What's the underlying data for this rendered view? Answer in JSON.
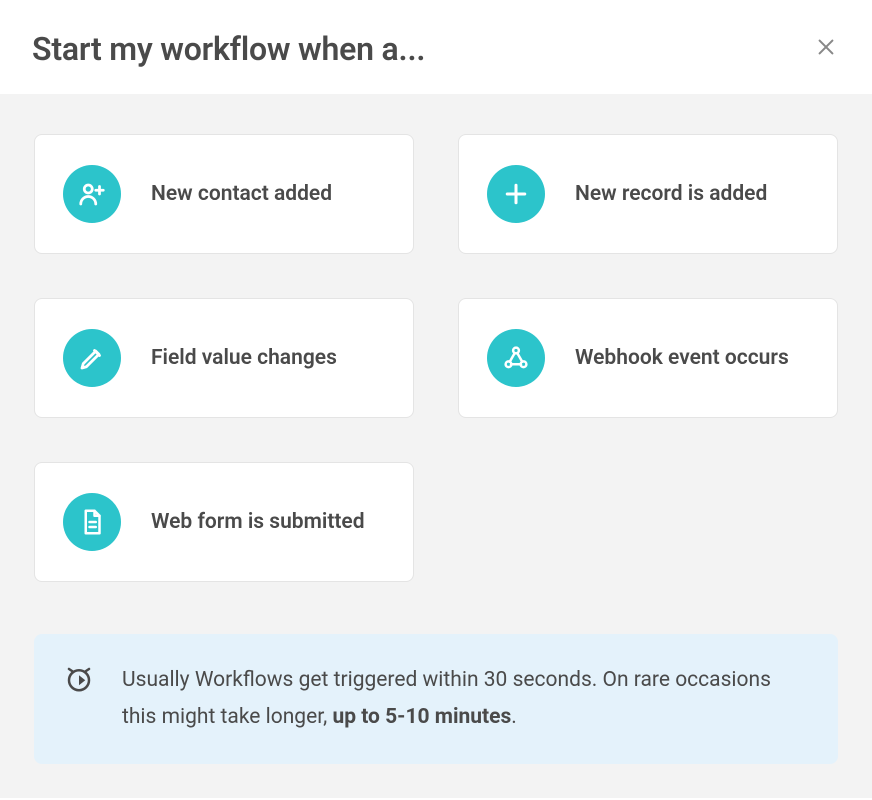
{
  "header": {
    "title": "Start my workflow when a..."
  },
  "triggers": [
    {
      "icon": "person-plus-icon",
      "label": "New contact added"
    },
    {
      "icon": "plus-icon",
      "label": "New record is added"
    },
    {
      "icon": "pencil-icon",
      "label": "Field value changes"
    },
    {
      "icon": "webhook-icon",
      "label": "Webhook event occurs"
    },
    {
      "icon": "form-icon",
      "label": "Web form is submitted"
    }
  ],
  "info": {
    "text_prefix": "Usually Workflows get triggered within 30 seconds. On rare occasions this might take longer, ",
    "text_bold": "up to 5-10 minutes",
    "text_suffix": "."
  },
  "colors": {
    "accent": "#2cc4cb",
    "info_bg": "#e4f2fb",
    "body_bg": "#f3f3f3"
  }
}
